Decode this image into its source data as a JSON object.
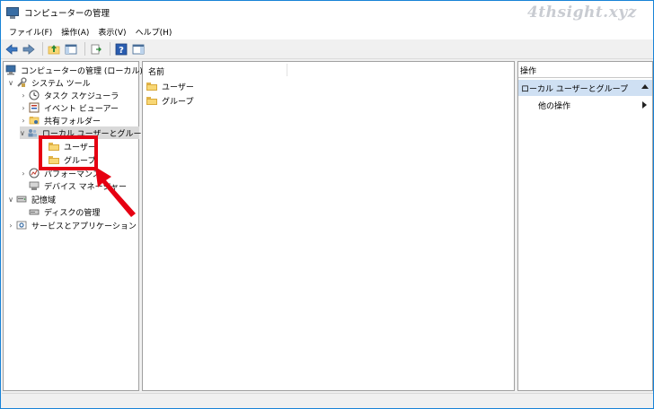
{
  "window": {
    "title": "コンピューターの管理",
    "watermark": "4thsight.xyz"
  },
  "menubar": {
    "items": [
      {
        "label": "ファイル(F)"
      },
      {
        "label": "操作(A)"
      },
      {
        "label": "表示(V)"
      },
      {
        "label": "ヘルプ(H)"
      }
    ]
  },
  "tree": {
    "root": "コンピューターの管理 (ローカル)",
    "system_tools": "システム ツール",
    "task_scheduler": "タスク スケジューラ",
    "event_viewer": "イベント ビューアー",
    "shared_folders": "共有フォルダー",
    "local_users_groups": "ローカル ユーザーとグループ",
    "users": "ユーザー",
    "groups": "グループ",
    "performance": "パフォーマンス",
    "device_manager": "デバイス マネージャー",
    "storage": "記憶域",
    "disk_management": "ディスクの管理",
    "services_apps": "サービスとアプリケーション"
  },
  "content": {
    "column_name": "名前",
    "items": [
      {
        "label": "ユーザー"
      },
      {
        "label": "グループ"
      }
    ]
  },
  "actions": {
    "title": "操作",
    "section": "ローカル ユーザーとグループ",
    "other": "他の操作"
  },
  "colors": {
    "highlight": "#e60012",
    "selection": "#cfe0f3",
    "folder": "#f8d775"
  }
}
